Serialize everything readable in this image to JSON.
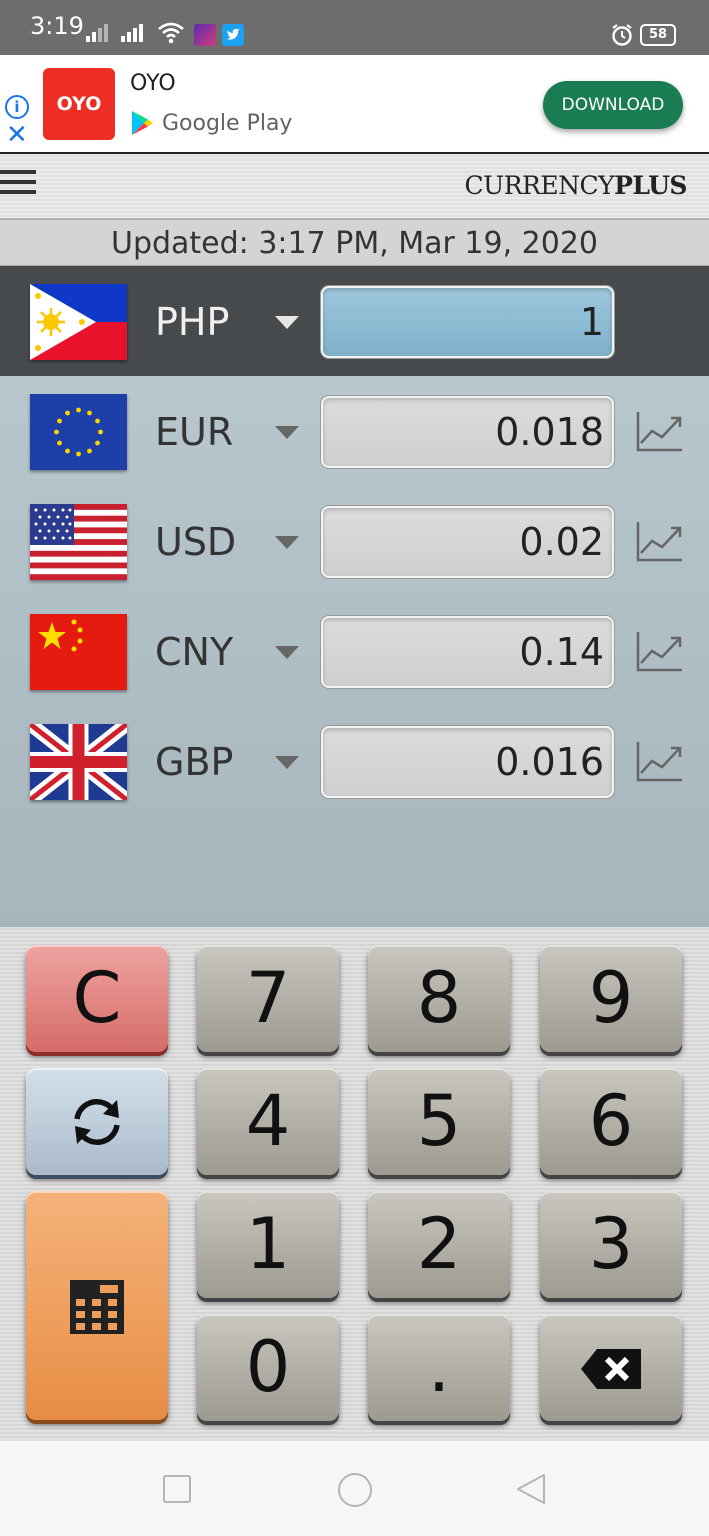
{
  "status_bar": {
    "time": "3:19",
    "battery": "58"
  },
  "ad": {
    "info": "i",
    "close": "✕",
    "logo_text": "OYO",
    "title": "OYO",
    "store": "Google Play",
    "download_label": "DOWNLOAD"
  },
  "header": {
    "brand_left": "CURRENCY",
    "brand_right": "PLUS"
  },
  "updated": "Updated: 3:17 PM, Mar 19, 2020",
  "base": {
    "code": "PHP",
    "value": "1",
    "flag": "philippines-flag"
  },
  "currencies": [
    {
      "code": "EUR",
      "value": "0.018",
      "flag": "eu-flag"
    },
    {
      "code": "USD",
      "value": "0.02",
      "flag": "us-flag"
    },
    {
      "code": "CNY",
      "value": "0.14",
      "flag": "china-flag"
    },
    {
      "code": "GBP",
      "value": "0.016",
      "flag": "uk-flag"
    }
  ],
  "keypad": {
    "clear": "C",
    "k7": "7",
    "k8": "8",
    "k9": "9",
    "k4": "4",
    "k5": "5",
    "k6": "6",
    "k1": "1",
    "k2": "2",
    "k3": "3",
    "k0": "0",
    "dot": "."
  },
  "colors": {
    "base_row_bg": "#464a4d",
    "list_bg": "#b8c6ce",
    "active_field": "#9dc7dc",
    "clear_key": "#e0837f",
    "swap_key": "#bccbd9",
    "calc_key": "#ee9d5b",
    "ad_button": "#1a7c52"
  }
}
